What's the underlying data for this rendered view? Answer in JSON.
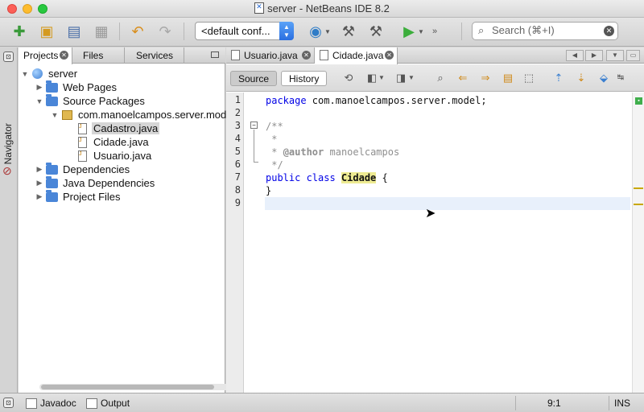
{
  "window": {
    "title": "server - NetBeans IDE 8.2"
  },
  "toolbar": {
    "config_value": "<default conf...",
    "search_placeholder": "Search (⌘+I)"
  },
  "navigator": {
    "label": "Navigator"
  },
  "project_panel": {
    "tabs": [
      {
        "label": "Projects",
        "active": true
      },
      {
        "label": "Files",
        "active": false
      },
      {
        "label": "Services",
        "active": false
      }
    ],
    "tree": [
      {
        "label": "server",
        "icon": "project-globe-icon",
        "expanded": true,
        "level": 0
      },
      {
        "label": "Web Pages",
        "icon": "folder-icon",
        "expanded": false,
        "level": 1
      },
      {
        "label": "Source Packages",
        "icon": "folder-icon",
        "expanded": true,
        "level": 1
      },
      {
        "label": "com.manoelcampos.server.mod",
        "icon": "package-icon",
        "expanded": true,
        "level": 2
      },
      {
        "label": "Cadastro.java",
        "icon": "java-file-icon",
        "level": 3,
        "selected": true
      },
      {
        "label": "Cidade.java",
        "icon": "java-file-icon",
        "level": 3
      },
      {
        "label": "Usuario.java",
        "icon": "java-file-icon",
        "level": 3
      },
      {
        "label": "Dependencies",
        "icon": "folder-icon",
        "expanded": false,
        "level": 1
      },
      {
        "label": "Java Dependencies",
        "icon": "folder-icon",
        "expanded": false,
        "level": 1
      },
      {
        "label": "Project Files",
        "icon": "folder-icon",
        "expanded": false,
        "level": 1
      }
    ]
  },
  "editor": {
    "tabs": [
      {
        "label": "Usuario.java",
        "active": false
      },
      {
        "label": "Cidade.java",
        "active": true
      }
    ],
    "view_buttons": {
      "source": "Source",
      "history": "History"
    },
    "lines": [
      {
        "n": "1",
        "parts": [
          [
            "kw",
            "package"
          ],
          [
            "",
            " com.manoelcampos.server.model;"
          ]
        ]
      },
      {
        "n": "2",
        "parts": []
      },
      {
        "n": "3",
        "parts": [
          [
            "cm",
            "/**"
          ]
        ]
      },
      {
        "n": "4",
        "parts": [
          [
            "cm",
            " *"
          ]
        ]
      },
      {
        "n": "5",
        "parts": [
          [
            "cm",
            " * "
          ],
          [
            "tag",
            "@author"
          ],
          [
            "cm",
            " manoelcampos"
          ]
        ]
      },
      {
        "n": "6",
        "parts": [
          [
            "cm",
            " */"
          ]
        ]
      },
      {
        "n": "7",
        "parts": [
          [
            "kw",
            "public class "
          ],
          [
            "hl",
            "Cidade"
          ],
          [
            "",
            " {"
          ]
        ]
      },
      {
        "n": "8",
        "parts": [
          [
            "",
            "}"
          ]
        ]
      },
      {
        "n": "9",
        "parts": [],
        "current": true
      }
    ]
  },
  "status_bar": {
    "javadoc_label": "Javadoc",
    "output_label": "Output",
    "caret_position": "9:1",
    "insert_mode": "INS"
  }
}
